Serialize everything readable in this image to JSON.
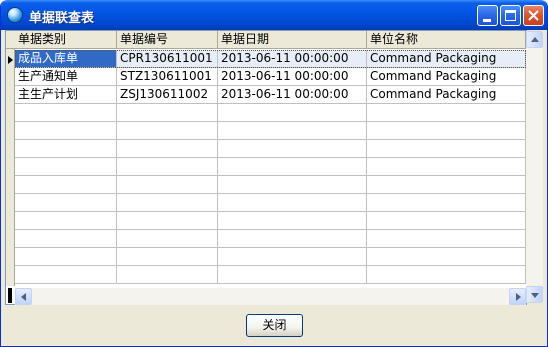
{
  "window": {
    "title": "单据联查表"
  },
  "grid": {
    "columns": [
      "单据类别",
      "单据编号",
      "单据日期",
      "单位名称"
    ],
    "rows": [
      [
        "成品入库单",
        "CPR130611001",
        "2013-06-11 00:00:00",
        "Command Packaging"
      ],
      [
        "生产通知单",
        "STZ130611001",
        "2013-06-11 00:00:00",
        "Command Packaging"
      ],
      [
        "主生产计划",
        "ZSJ130611002",
        "2013-06-11 00:00:00",
        "Command Packaging"
      ]
    ]
  },
  "footer": {
    "close_label": "关闭"
  },
  "colors": {
    "titlebar": "#0054e3",
    "selection": "#316ac5",
    "window_bg": "#ece9d8"
  },
  "icons": [
    "app-globe-icon",
    "minimize-icon",
    "maximize-icon",
    "close-icon",
    "row-pointer-icon",
    "scroll-up-icon",
    "scroll-down-icon",
    "scroll-left-icon",
    "scroll-right-icon"
  ]
}
